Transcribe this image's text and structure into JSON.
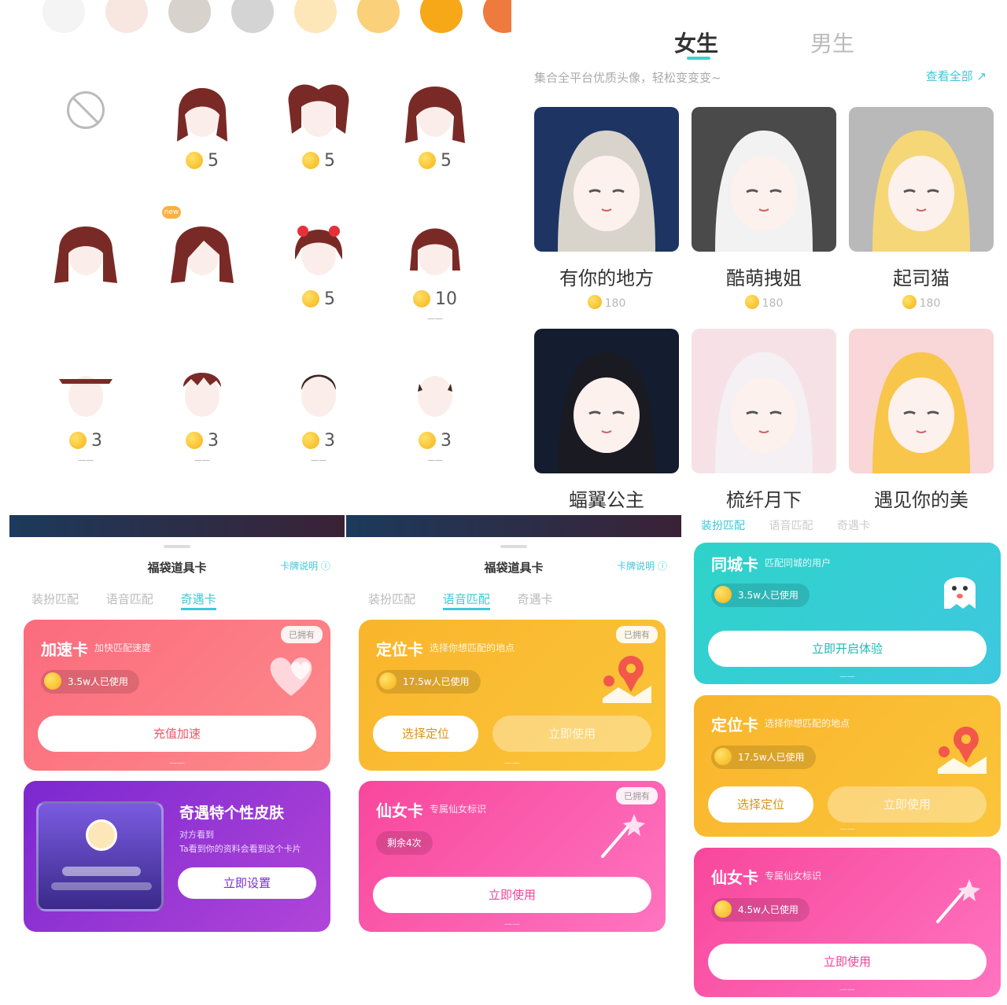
{
  "hair_picker": {
    "swatches": [
      "#f4f4f4",
      "#f8e6e0",
      "#d8d2cc",
      "#d4d4d4",
      "#fde7b8",
      "#fbd07a",
      "#f6a818",
      "#ee7a3e"
    ],
    "rows": [
      [
        {
          "kind": "none",
          "price": ""
        },
        {
          "kind": "long-braid",
          "price": "5"
        },
        {
          "kind": "twin-buns",
          "price": "5"
        },
        {
          "kind": "curly-long",
          "price": "5"
        }
      ],
      [
        {
          "kind": "long-wavy",
          "price": ""
        },
        {
          "kind": "side-bangs",
          "price": "",
          "badge": "new"
        },
        {
          "kind": "red-bow",
          "price": "5"
        },
        {
          "kind": "bob",
          "price": "10",
          "sub": "——"
        }
      ],
      [
        {
          "kind": "short-flat",
          "price": "3",
          "sub": "——"
        },
        {
          "kind": "short-spiky",
          "price": "3",
          "sub": "——"
        },
        {
          "kind": "short-side",
          "price": "3",
          "sub": "——"
        },
        {
          "kind": "buzz",
          "price": "3",
          "sub": "——"
        }
      ]
    ],
    "hair_color": "#7a2a26",
    "skin_color": "#fbeeea"
  },
  "gallery": {
    "tab_female": "女生",
    "tab_male": "男生",
    "subtitle": "集合全平台优质头像，轻松变变变~",
    "link": "查看全部 ↗",
    "avatars": [
      {
        "name": "有你的地方",
        "price": "180",
        "bg": "#1e3564"
      },
      {
        "name": "酷萌拽姐",
        "price": "180",
        "bg": "#4a4a4a"
      },
      {
        "name": "起司猫",
        "price": "180",
        "bg": "#b9b9b9"
      },
      {
        "name": "蝠翼公主",
        "price": "",
        "bg": "#141c30"
      },
      {
        "name": "梳纤月下",
        "price": "",
        "bg": "#f6e2e6"
      },
      {
        "name": "遇见你的美",
        "price": "",
        "bg": "#f9d6d8"
      }
    ],
    "bottom_tabs": [
      "装扮匹配",
      "语音匹配",
      "奇遇卡"
    ]
  },
  "prop_panels": [
    {
      "title": "福袋道具卡",
      "help": "卡牌说明 ⓘ",
      "tabs": [
        "装扮匹配",
        "语音匹配",
        "奇遇卡"
      ],
      "active_tab": 2,
      "cards": [
        {
          "title": "加速卡",
          "desc": "加快匹配速度",
          "badge": "已拥有",
          "stat": "3.5w人已使用",
          "button": "充值加速",
          "foot": "——"
        },
        {
          "title": "奇遇特个性皮肤",
          "desc": "对方看到",
          "desc2": "Ta看到你的资料会看到这个卡片",
          "button": "立即设置"
        }
      ]
    },
    {
      "title": "福袋道具卡",
      "help": "卡牌说明 ⓘ",
      "tabs": [
        "装扮匹配",
        "语音匹配",
        "奇遇卡"
      ],
      "active_tab": 1,
      "cards": [
        {
          "title": "定位卡",
          "desc": "选择你想匹配的地点",
          "badge": "已拥有",
          "stat": "17.5w人已使用",
          "button": "选择定位",
          "button2": "立即使用",
          "foot": "——"
        },
        {
          "title": "仙女卡",
          "desc": "专属仙女标识",
          "badge": "已拥有",
          "stat": "剩余4次",
          "button": "立即使用",
          "foot": "——"
        }
      ]
    },
    {
      "cards": [
        {
          "title": "同城卡",
          "desc": "匹配同城的用户",
          "stat": "3.5w人已使用",
          "button": "立即开启体验",
          "foot": "——"
        },
        {
          "title": "定位卡",
          "desc": "选择你想匹配的地点",
          "stat": "17.5w人已使用",
          "button": "选择定位",
          "button2": "立即使用",
          "foot": "——"
        },
        {
          "title": "仙女卡",
          "desc": "专属仙女标识",
          "stat": "4.5w人已使用",
          "button": "立即使用",
          "foot": "——"
        }
      ]
    }
  ],
  "colors": {
    "accent": "#3ec8d8",
    "pink_card": "#fb6b7e",
    "orange_card": "#f9b52c",
    "magenta_card": "#f8479c",
    "purple_card": "#8a2fd4",
    "teal_card": "#2ed3c9"
  }
}
